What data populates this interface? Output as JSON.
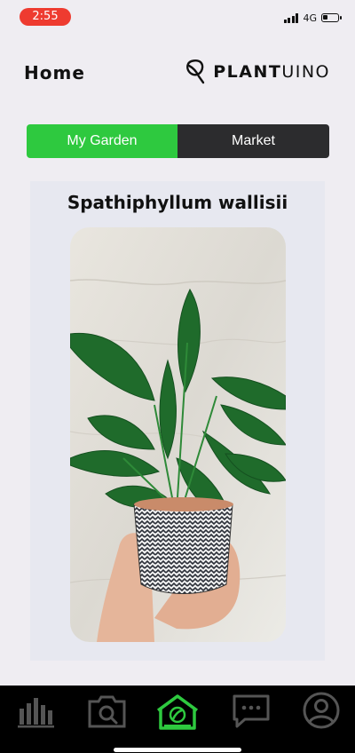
{
  "status_bar": {
    "time": "2:55",
    "network": "4G",
    "battery_level": 0.3
  },
  "header": {
    "title": "Home",
    "brand_bold": "PLANT",
    "brand_light": "UINO"
  },
  "tabs": [
    {
      "label": "My Garden",
      "active": true
    },
    {
      "label": "Market",
      "active": false
    }
  ],
  "plant": {
    "name": "Spathiphyllum wallisii"
  },
  "bottom_nav": [
    {
      "icon": "stats-icon",
      "active": false
    },
    {
      "icon": "camera-search-icon",
      "active": false
    },
    {
      "icon": "greenhouse-icon",
      "active": true
    },
    {
      "icon": "chat-icon",
      "active": false
    },
    {
      "icon": "profile-icon",
      "active": false
    }
  ],
  "colors": {
    "accent": "#2ec93f",
    "inactive_tab": "#2c2c2e",
    "time_pill": "#ee3b30",
    "nav_icon": "#555555"
  }
}
